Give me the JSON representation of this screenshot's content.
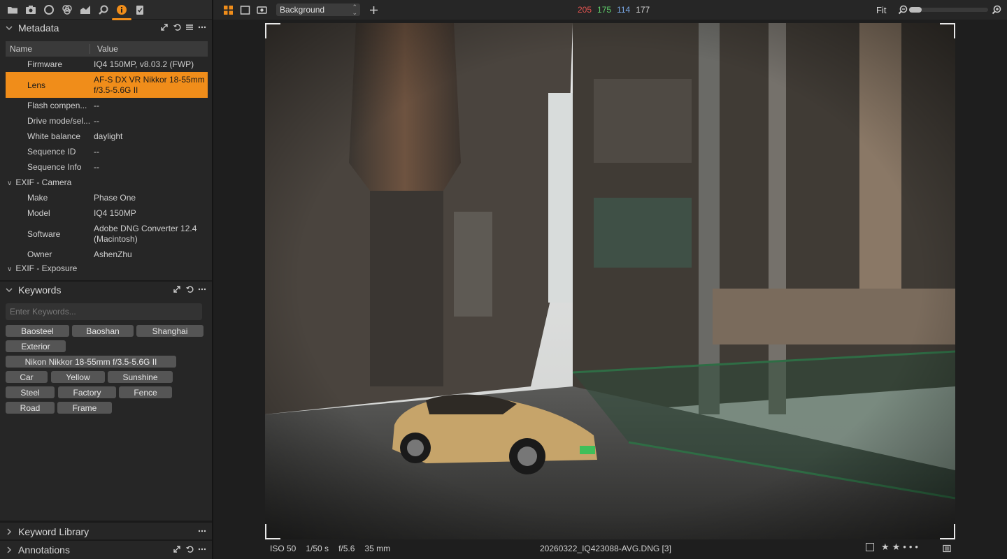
{
  "tool_tabs": [
    {
      "icon": "folder-icon"
    },
    {
      "icon": "camera-icon"
    },
    {
      "icon": "lens-circle-icon"
    },
    {
      "icon": "color-circles-icon"
    },
    {
      "icon": "exposure-icon"
    },
    {
      "icon": "search-loupe-icon"
    },
    {
      "icon": "info-icon",
      "active": true
    },
    {
      "icon": "clipboard-check-icon"
    }
  ],
  "metadata": {
    "title": "Metadata",
    "col_name": "Name",
    "col_value": "Value",
    "rows": [
      {
        "name": "Firmware",
        "value": "IQ4 150MP, v8.03.2 (FWP)"
      },
      {
        "name": "Lens",
        "value": "AF-S DX VR Nikkor 18-55mm f/3.5-5.6G II",
        "selected": true
      },
      {
        "name": "Flash compen...",
        "value": "--"
      },
      {
        "name": "Drive mode/sel...",
        "value": "--"
      },
      {
        "name": "White balance",
        "value": "daylight"
      },
      {
        "name": "Sequence ID",
        "value": "--"
      },
      {
        "name": "Sequence Info",
        "value": "--"
      }
    ],
    "group_camera": "EXIF - Camera",
    "camera_rows": [
      {
        "name": "Make",
        "value": "Phase One"
      },
      {
        "name": "Model",
        "value": "IQ4 150MP"
      },
      {
        "name": "Software",
        "value": "Adobe DNG Converter 12.4 (Macintosh)"
      },
      {
        "name": "Owner",
        "value": "AshenZhu"
      }
    ],
    "group_exposure": "EXIF - Exposure"
  },
  "keywords": {
    "title": "Keywords",
    "placeholder": "Enter Keywords...",
    "chips": [
      "Baosteel",
      "Baoshan",
      "Shanghai",
      "Exterior",
      "Nikon Nikkor 18-55mm f/3.5-5.6G II",
      "Car",
      "Yellow",
      "Sunshine",
      "Steel",
      "Factory",
      "Fence",
      "Road",
      "Frame"
    ]
  },
  "keyword_library": {
    "title": "Keyword Library"
  },
  "annotations": {
    "title": "Annotations"
  },
  "topbar": {
    "background_select": "Background",
    "rgb": {
      "r": "205",
      "g": "175",
      "b": "114",
      "l": "177"
    },
    "zoom_label": "Fit",
    "zoom_level": 0.05
  },
  "bottombar": {
    "iso": "ISO 50",
    "shutter": "1/50 s",
    "aperture": "f/5.6",
    "focal": "35 mm",
    "filename": "20260322_IQ423088-AVG.DNG [3]",
    "stars": "★★•••"
  },
  "colors": {
    "accent": "#f08d1a",
    "red": "#e0534f",
    "green": "#5fcf6a",
    "blue": "#7aa9e8"
  }
}
